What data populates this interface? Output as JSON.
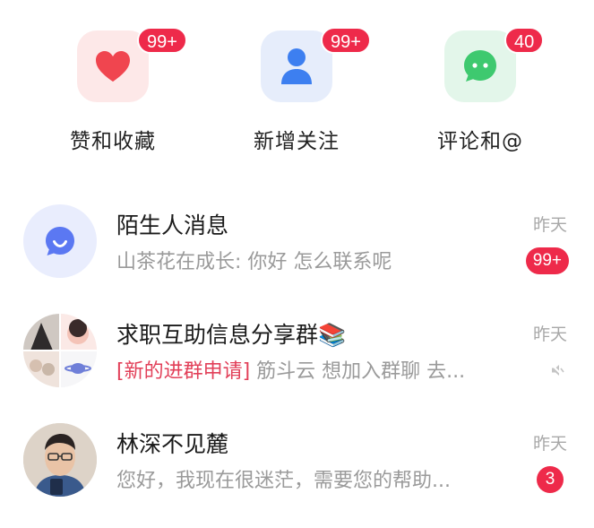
{
  "categories": [
    {
      "label": "赞和收藏",
      "badge": "99+",
      "icon": "heart-icon",
      "color": "#f0454f"
    },
    {
      "label": "新增关注",
      "badge": "99+",
      "icon": "person-icon",
      "color": "#3d7ff0"
    },
    {
      "label": "评论和@",
      "badge": "40",
      "icon": "chat-bubble-icon",
      "color": "#3ec96f"
    }
  ],
  "messages": [
    {
      "title": "陌生人消息",
      "sender": "山茶花在成长:",
      "preview": "你好 怎么联系呢",
      "time": "昨天",
      "badge": "99+"
    },
    {
      "title": "求职互助信息分享群",
      "title_emoji": "📚",
      "tag": "[新的进群申请]",
      "preview": "筋斗云 想加入群聊 去...",
      "time": "昨天",
      "muted": true
    },
    {
      "title": "林深不见麓",
      "preview": "您好，我现在很迷茫，需要您的帮助...",
      "time": "昨天",
      "badge": "3"
    }
  ],
  "colors": {
    "badge": "#ee2a4a",
    "accent_text": "#e24059"
  }
}
